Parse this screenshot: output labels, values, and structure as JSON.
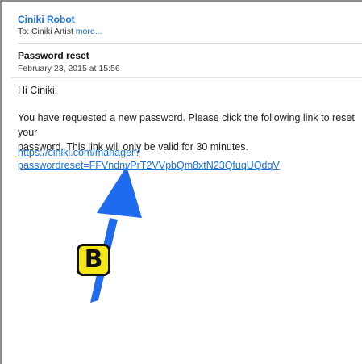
{
  "email": {
    "sender": "Ciniki Robot",
    "to_prefix": "To:",
    "to_name": "Ciniki Artist",
    "to_more": "more...",
    "subject": "Password reset",
    "date": "February 23, 2015 at 15:56",
    "greeting": "Hi Ciniki,",
    "body_line1": "You have requested a new password.  Please click the following link to reset your",
    "body_line2": "password.  This link will only be valid for 30 minutes.",
    "link_line1": "https://ciniki.com/manager?",
    "link_line2": "passwordreset=FFVndnvPrT2VVpbQm8xtN23QfuqUQdqV"
  },
  "annotation": {
    "badge_label": "B",
    "arrow_color": "#1f6bef",
    "badge_color": "#f5e61a"
  }
}
